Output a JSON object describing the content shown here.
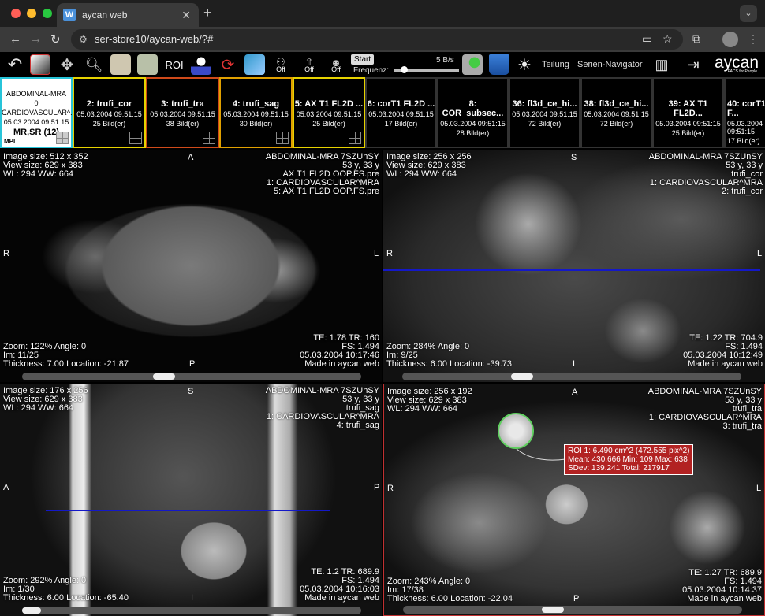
{
  "browser": {
    "tab_title": "aycan web",
    "url": "ser-store10/aycan-web/?#"
  },
  "toolbar": {
    "roi_label": "ROI",
    "off_label_1": "Off",
    "off_label_2": "Off",
    "off_label_3": "Off",
    "start_label": "Start",
    "freq_label": "Frequenz:",
    "rate_label": "5 B/s",
    "teilung_label": "Teilung",
    "serien_navigator_label": "Serien-Navigator",
    "logo_text": "aycan",
    "logo_tagline": "PACS for People"
  },
  "series": [
    {
      "title": "ABDOMINAL-MRA",
      "count": "0",
      "sub": "CARDIOVASCULAR^...",
      "date": "05.03.2004 09:51:15",
      "modality": "MR,SR (12)",
      "tag": "MPI"
    },
    {
      "title": "2: trufi_cor",
      "date": "05.03.2004 09:51:15",
      "images": "25 Bild(er)"
    },
    {
      "title": "3: trufi_tra",
      "date": "05.03.2004 09:51:15",
      "images": "38 Bild(er)"
    },
    {
      "title": "4: trufi_sag",
      "date": "05.03.2004 09:51:15",
      "images": "30 Bild(er)"
    },
    {
      "title": "5: AX T1 FL2D ...",
      "date": "05.03.2004 09:51:15",
      "images": "25 Bild(er)"
    },
    {
      "title": "6: corT1 FL2D ...",
      "date": "05.03.2004 09:51:15",
      "images": "17 Bild(er)"
    },
    {
      "title": "8: COR_subsec...",
      "date": "05.03.2004 09:51:15",
      "images": "28 Bild(er)"
    },
    {
      "title": "36: fl3d_ce_hi...",
      "date": "05.03.2004 09:51:15",
      "images": "72 Bild(er)"
    },
    {
      "title": "38: fl3d_ce_hi...",
      "date": "05.03.2004 09:51:15",
      "images": "72 Bild(er)"
    },
    {
      "title": "39: AX T1 FL2D...",
      "date": "05.03.2004 09:51:15",
      "images": "25 Bild(er)"
    },
    {
      "title": "40: corT1 F...",
      "date": "05.03.2004 09:51:15",
      "images": "17 Bild(er)"
    }
  ],
  "viewports": [
    {
      "tl": [
        "Image size: 512 x 352",
        "View size: 629 x 383",
        "WL: 294 WW: 664"
      ],
      "tr": [
        "ABDOMINAL-MRA 7SZUnSY",
        "53 y, 33 y",
        "AX T1 FL2D OOP.FS.pre",
        "1: CARDIOVASCULAR^MRA",
        "5: AX T1 FL2D OOP.FS.pre"
      ],
      "bl": [
        "Zoom: 122% Angle: 0",
        "Im: 11/25",
        "Thickness: 7.00 Location: -21.87"
      ],
      "br": [
        "TE: 1.78 TR: 160",
        "FS: 1.494",
        "05.03.2004 10:17:46",
        "Made in aycan web"
      ],
      "top": "A",
      "bottom": "P",
      "left": "R",
      "right": "L"
    },
    {
      "tl": [
        "Image size: 256 x 256",
        "View size: 629 x 383",
        "WL: 294 WW: 664"
      ],
      "tr": [
        "ABDOMINAL-MRA 7SZUnSY",
        "53 y, 33 y",
        "trufi_cor",
        "1: CARDIOVASCULAR^MRA",
        "2: trufi_cor"
      ],
      "bl": [
        "Zoom: 284% Angle: 0",
        "Im: 9/25",
        "Thickness: 6.00 Location: -39.73"
      ],
      "br": [
        "TE: 1.22 TR: 704.9",
        "FS: 1.494",
        "05.03.2004 10:12:49",
        "Made in aycan web"
      ],
      "top": "S",
      "bottom": "I",
      "left": "R",
      "right": "L"
    },
    {
      "tl": [
        "Image size: 176 x 256",
        "View size: 629 x 383",
        "WL: 294 WW: 664"
      ],
      "tr": [
        "ABDOMINAL-MRA 7SZUnSY",
        "53 y, 33 y",
        "trufi_sag",
        "1: CARDIOVASCULAR^MRA",
        "4: trufi_sag"
      ],
      "bl": [
        "Zoom: 292% Angle: 0",
        "Im: 1/30",
        "Thickness: 6.00 Location: -65.40"
      ],
      "br": [
        "TE: 1.2 TR: 689.9",
        "FS: 1.494",
        "05.03.2004 10:16:03",
        "Made in aycan web"
      ],
      "top": "S",
      "bottom": "I",
      "left": "A",
      "right": "P"
    },
    {
      "tl": [
        "Image size: 256 x 192",
        "View size: 629 x 383",
        "WL: 294 WW: 664"
      ],
      "tr": [
        "ABDOMINAL-MRA 7SZUnSY",
        "53 y, 33 y",
        "trufi_tra",
        "1: CARDIOVASCULAR^MRA",
        "3: trufi_tra"
      ],
      "bl": [
        "Zoom: 243% Angle: 0",
        "Im: 17/38",
        "Thickness: 6.00 Location: -22.04"
      ],
      "br": [
        "TE: 1.27 TR: 689.9",
        "FS: 1.494",
        "05.03.2004 10:14:37",
        "Made in aycan web"
      ],
      "top": "A",
      "bottom": "P",
      "left": "R",
      "right": "L",
      "roi": [
        "ROI 1: 6.490 cm^2 (472.555 pix^2)",
        "Mean: 430.666 Min: 109 Max: 638",
        "SDev: 139.241 Total: 217917"
      ]
    }
  ],
  "colors": {
    "active_series": "#27c4d9",
    "series_yellow": "#e6d200",
    "series_red": "#d04a1a",
    "series_orange": "#e0a000",
    "position_line": "#1418c8",
    "roi_circle": "#5fd05f",
    "roi_label_bg": "#b22222",
    "active_viewport_border": "#c03030"
  }
}
